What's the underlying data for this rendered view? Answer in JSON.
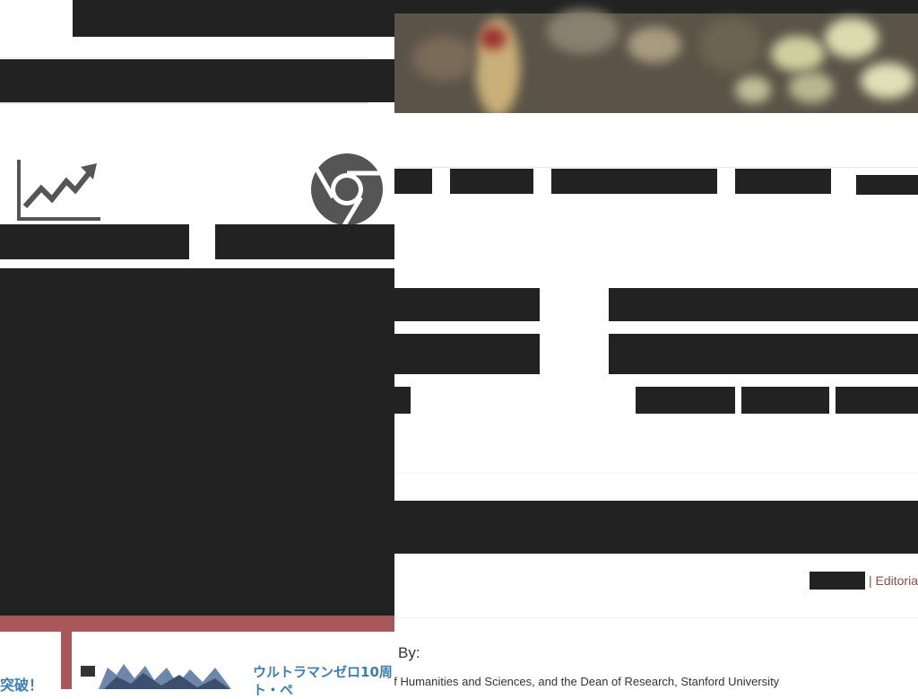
{
  "page": {
    "byline_label": "By:",
    "author_line": "of Humanities and Sciences, and the Dean of Research, Stanford University",
    "section_link": "| Editoria"
  },
  "overlay": {
    "icons": [
      "trending-up-icon",
      "chrome-icon"
    ],
    "promo": {
      "left_text": "突破！",
      "title": "ウルトラマンゼロ10周",
      "subtitle": "ト・ペ"
    }
  },
  "colors": {
    "redacted": "#222222",
    "accent_red": "#a8575b",
    "link_blue": "#3a7fb5",
    "section_link": "#8b4f4f",
    "icon_gray": "#555555"
  }
}
